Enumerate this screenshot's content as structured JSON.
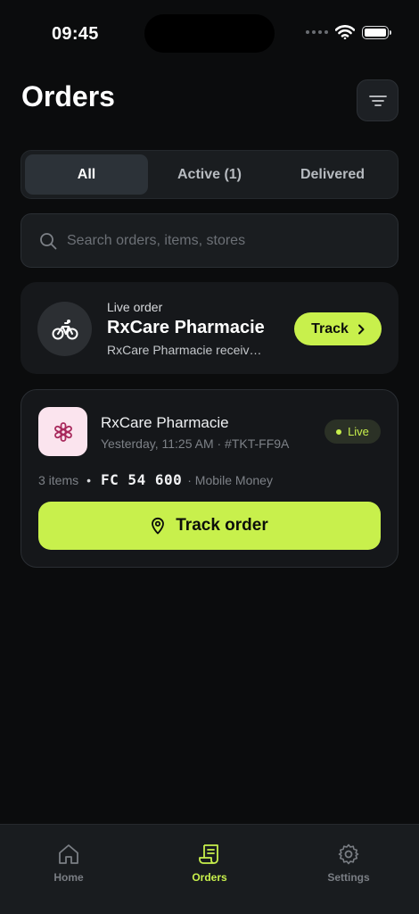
{
  "status_bar": {
    "time": "09:45"
  },
  "header": {
    "title": "Orders",
    "filter_icon": "filter-icon"
  },
  "tabs": [
    {
      "label": "All",
      "active": true
    },
    {
      "label": "Active (1)",
      "active": false
    },
    {
      "label": "Delivered",
      "active": false
    }
  ],
  "search": {
    "placeholder": "Search orders, items, stores",
    "value": ""
  },
  "live_banner": {
    "label": "Live order",
    "store": "RxCare Pharmacie",
    "subtitle": "RxCare Pharmacie receiv…",
    "track_label": "Track",
    "icon": "bicycle-icon"
  },
  "order": {
    "store": "RxCare Pharmacie",
    "meta": "Yesterday, 11:25 AM · #TKT-FF9A",
    "badge": "Live",
    "items": "3 items",
    "bullet": "•",
    "price": "FC 54 600",
    "payment": "· Mobile Money",
    "track_label": "Track order"
  },
  "nav": {
    "home": "Home",
    "orders": "Orders",
    "settings": "Settings"
  },
  "colors": {
    "accent": "#c8f04c",
    "background": "#0b0c0d",
    "card": "#15171a",
    "logo_bg": "#fbe4ee",
    "logo_fg": "#a8295c"
  }
}
